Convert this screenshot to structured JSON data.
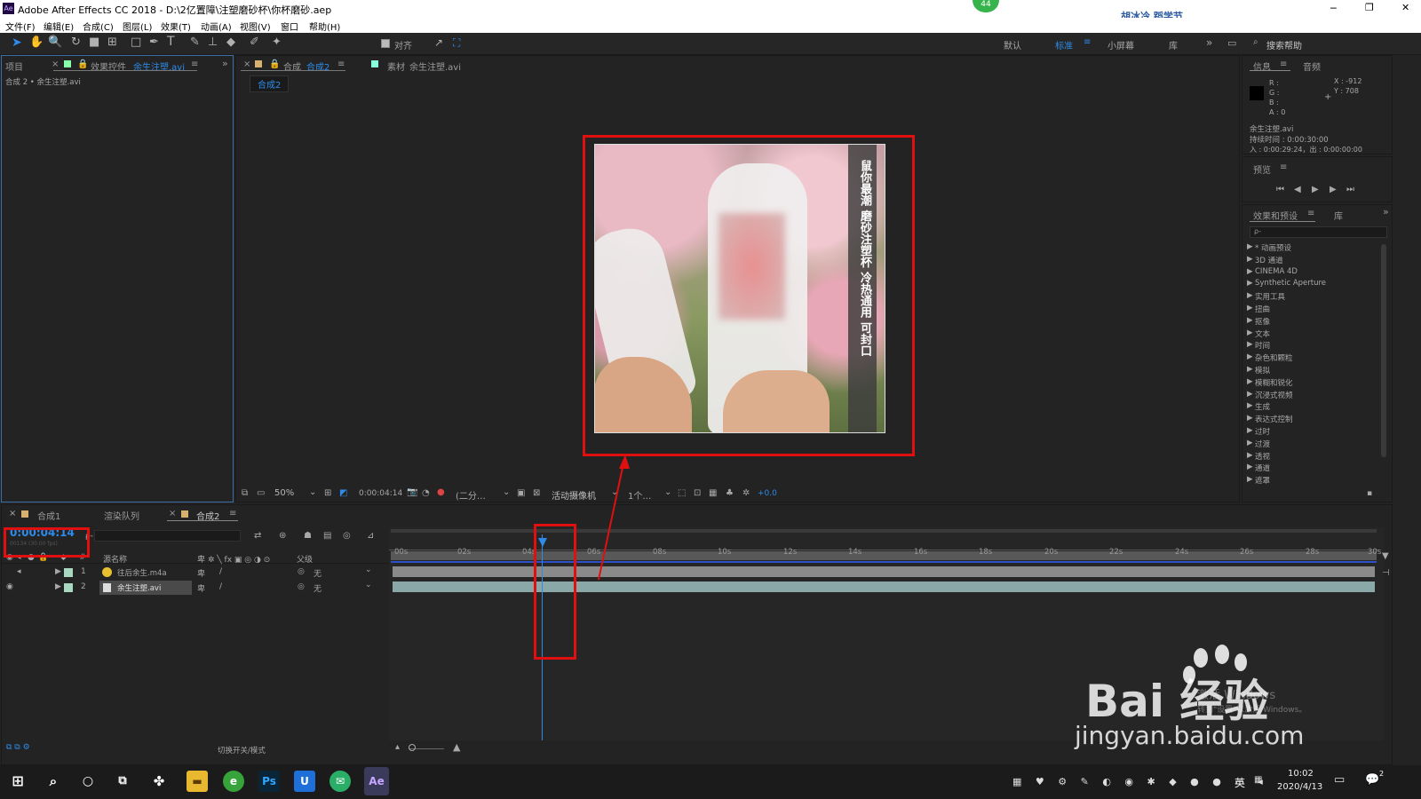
{
  "app": {
    "title": "Adobe After Effects CC 2018 - D:\\2亿置障\\注塑磨砂杯\\你杯磨砂.aep",
    "icon_label": "Ae"
  },
  "titlebar_overlay": {
    "badge": "44",
    "right_text": "胡冰冷 蹈学节"
  },
  "window_controls": {
    "minimize": "─",
    "restore": "❐",
    "close": "✕"
  },
  "menu": [
    "文件(F)",
    "编辑(E)",
    "合成(C)",
    "图层(L)",
    "效果(T)",
    "动画(A)",
    "视图(V)",
    "窗口",
    "帮助(H)"
  ],
  "toolbar": {
    "align_label": "对齐",
    "workspaces": [
      "默认",
      "标准",
      "小屏幕",
      "库"
    ],
    "search_help": "搜索帮助"
  },
  "project_panel": {
    "tab_project": "项目",
    "tab_effects": "效果控件",
    "tab_effects_target": "余生注塑.avi",
    "breadcrumb": "合成 2 • 余生注塑.avi"
  },
  "comp_panel": {
    "tab_comp_prefix": "合成",
    "tab_comp_name": "合成2",
    "tab_footage_prefix": "素材",
    "tab_footage_name": "余生注塑.avi",
    "subtab": "合成2",
    "overlay_text": "鼠你最潮 磨砂注塑杯 冷热通用 可封口",
    "zoom": "50%",
    "timecode": "0:00:04:14",
    "resolution": "(二分…",
    "camera": "活动摄像机",
    "views": "1个…",
    "exposure": "+0.0"
  },
  "info_panel": {
    "tab_info": "信息",
    "tab_audio": "音频",
    "r": "R :",
    "g": "G :",
    "b": "B :",
    "a": "A : 0",
    "x": "X : -912",
    "y": "Y : 708",
    "file": "余生注塑.avi",
    "duration": "持续时间 : 0:00:30:00",
    "inout": "入 : 0:00:29:24，出 : 0:00:00:00"
  },
  "preview_panel": {
    "title": "预览"
  },
  "effects_panel": {
    "title": "效果和预设",
    "tab_lib": "库",
    "search_placeholder": "ρ-",
    "items": [
      "* 动画预设",
      "3D 通道",
      "CINEMA 4D",
      "Synthetic Aperture",
      "实用工具",
      "扭曲",
      "抠像",
      "文本",
      "时间",
      "杂色和颗粒",
      "模拟",
      "模糊和锐化",
      "沉浸式视频",
      "生成",
      "表达式控制",
      "过时",
      "过渡",
      "透视",
      "通道",
      "遮罩"
    ]
  },
  "timeline": {
    "tabs": [
      "合成1",
      "渲染队列",
      "合成2"
    ],
    "timecode": "0:00:04:14",
    "timecode_sub": "00134 (30.00 fps)",
    "search_placeholder": "ρ-",
    "col_num": "#",
    "col_source": "源名称",
    "col_parent": "父级",
    "ruler": [
      "00s",
      "02s",
      "04s",
      "06s",
      "08s",
      "10s",
      "12s",
      "14s",
      "16s",
      "18s",
      "20s",
      "22s",
      "24s",
      "26s",
      "28s",
      "30s"
    ],
    "layers": [
      {
        "num": "1",
        "name": "往后余生.m4a",
        "parent": "无"
      },
      {
        "num": "2",
        "name": "余生注塑.avi",
        "parent": "无"
      }
    ],
    "footer": "切换开关/模式"
  },
  "watermark": {
    "logo": "Bai 经验",
    "url": "jingyan.baidu.com",
    "activate": "激活 Windows",
    "activate_sub": "转到\"设置\"以激活 Windows。"
  },
  "taskbar": {
    "time": "10:02",
    "date": "2020/4/13",
    "ime": "英",
    "badge": "2"
  },
  "colors": {
    "accent": "#2d8ceb",
    "highlight": "#e01010",
    "panel": "#232323",
    "layer_bar": "#8aa8a8"
  }
}
